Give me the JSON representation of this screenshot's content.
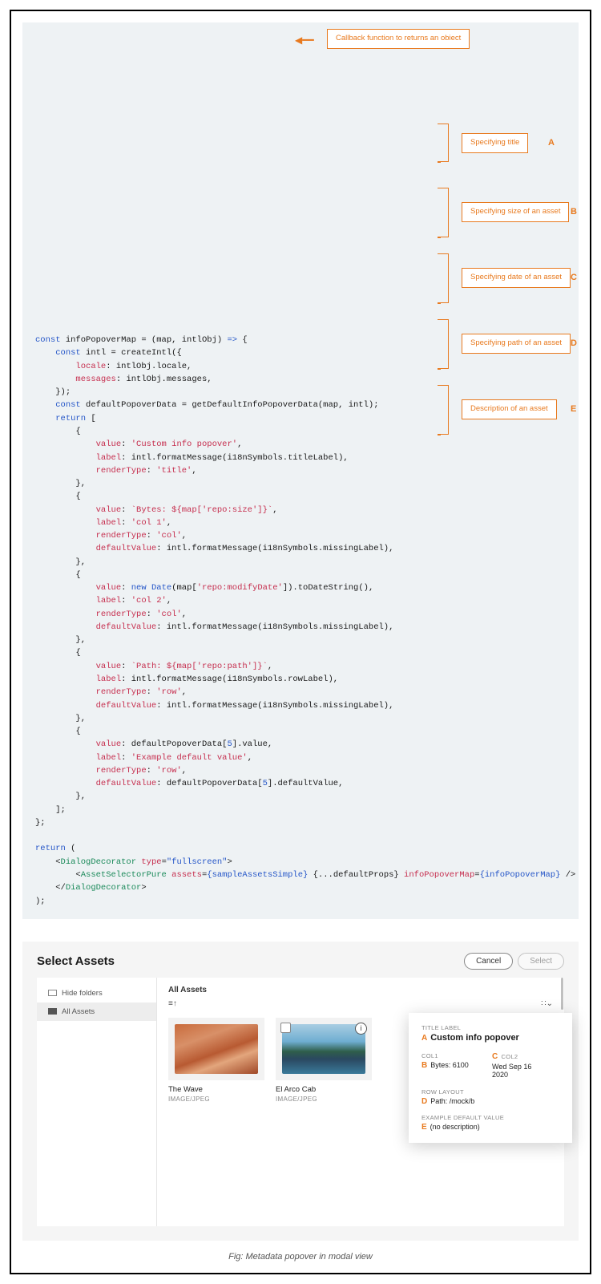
{
  "code": {
    "callout_top": "Callback function to returns an obiect",
    "annots": {
      "a": {
        "text": "Specifying title",
        "letter": "A"
      },
      "b": {
        "text": "Specifying size of an asset",
        "letter": "B"
      },
      "c": {
        "text": "Specifying date of an asset",
        "letter": "C"
      },
      "d": {
        "text": "Specifying path of an asset",
        "letter": "D"
      },
      "e": {
        "text": "Description of an asset",
        "letter": "E"
      }
    },
    "lines": {
      "l1_a": "const",
      "l1_b": " infoPopoverMap = (map, intlObj) ",
      "l1_c": "=>",
      "l1_d": " {",
      "l2_a": "const",
      "l2_b": " intl = createIntl({",
      "l3_a": "locale",
      "l3_b": ": intlObj.locale,",
      "l4_a": "messages",
      "l4_b": ": intlObj.messages,",
      "l5": "});",
      "l6_a": "const",
      "l6_b": " defaultPopoverData = getDefaultInfoPopoverData(map, intl);",
      "l7_a": "return",
      "l7_b": " [",
      "l8": "{",
      "l9_a": "value",
      "l9_b": ": ",
      "l9_c": "'Custom info popover'",
      "l9_d": ",",
      "l10_a": "label",
      "l10_b": ": intl.formatMessage(i18nSymbols.titleLabel),",
      "l11_a": "renderType",
      "l11_b": ": ",
      "l11_c": "'title'",
      "l11_d": ",",
      "l12": "},",
      "l13": "{",
      "l14_a": "value",
      "l14_b": ": ",
      "l14_c": "`Bytes: ${map['repo:size']}`",
      "l14_d": ",",
      "l15_a": "label",
      "l15_b": ": ",
      "l15_c": "'col 1'",
      "l15_d": ",",
      "l16_a": "renderType",
      "l16_b": ": ",
      "l16_c": "'col'",
      "l16_d": ",",
      "l17_a": "defaultValue",
      "l17_b": ": intl.formatMessage(i18nSymbols.missingLabel),",
      "l18": "},",
      "l19": "{",
      "l20_a": "value",
      "l20_b": ": ",
      "l20_c": "new",
      "l20_d": " ",
      "l20_e": "Date",
      "l20_f": "(map[",
      "l20_g": "'repo:modifyDate'",
      "l20_h": "]).toDateString(),",
      "l21_a": "label",
      "l21_b": ": ",
      "l21_c": "'col 2'",
      "l21_d": ",",
      "l22_a": "renderType",
      "l22_b": ": ",
      "l22_c": "'col'",
      "l22_d": ",",
      "l23_a": "defaultValue",
      "l23_b": ": intl.formatMessage(i18nSymbols.missingLabel),",
      "l24": "},",
      "l25": "{",
      "l26_a": "value",
      "l26_b": ": ",
      "l26_c": "`Path: ${map['repo:path']}`",
      "l26_d": ",",
      "l27_a": "label",
      "l27_b": ": intl.formatMessage(i18nSymbols.rowLabel),",
      "l28_a": "renderType",
      "l28_b": ": ",
      "l28_c": "'row'",
      "l28_d": ",",
      "l29_a": "defaultValue",
      "l29_b": ": intl.formatMessage(i18nSymbols.missingLabel),",
      "l30": "},",
      "l31": "{",
      "l32_a": "value",
      "l32_b": ": defaultPopoverData[",
      "l32_c": "5",
      "l32_d": "].value,",
      "l33_a": "label",
      "l33_b": ": ",
      "l33_c": "'Example default value'",
      "l33_d": ",",
      "l34_a": "renderType",
      "l34_b": ": ",
      "l34_c": "'row'",
      "l34_d": ",",
      "l35_a": "defaultValue",
      "l35_b": ": defaultPopoverData[",
      "l35_c": "5",
      "l35_d": "].defaultValue,",
      "l36": "},",
      "l37": "];",
      "l38": "};",
      "ret": "return",
      "ret2": " (",
      "dd_open_a": "DialogDecorator",
      "dd_type": "type",
      "dd_type_v": "\"fullscreen\"",
      "asp": "AssetSelectorPure",
      "asp_assets": "assets",
      "asp_assets_v": "{sampleAssetsSimple}",
      "asp_rest": " {...defaultProps} ",
      "asp_ipm": "infoPopoverMap",
      "asp_ipm_v": "{infoPopoverMap}",
      "dd_close": "DialogDecorator",
      "close_paren": ");"
    }
  },
  "modal": {
    "title": "Select Assets",
    "cancel": "Cancel",
    "select": "Select",
    "hide_folders": "Hide folders",
    "all_assets_side": "All Assets",
    "crumb": "All Assets",
    "card1_title": "The Wave",
    "card1_sub": "IMAGE/JPEG",
    "card2_title": "El Arco Cab",
    "card2_sub": "IMAGE/JPEG",
    "sort_icon": "≡↑",
    "grid_icon": "∷⌄"
  },
  "popover": {
    "title_label": "TITLE LABEL",
    "title_value": "Custom info popover",
    "col1_label": "COL1",
    "col1_value": "Bytes: 6100",
    "col2_label": "COL2",
    "col2_value_l1": "Wed Sep 16",
    "col2_value_l2": "2020",
    "row_label": "ROW LAYOUT",
    "row_value": "Path: /mock/b",
    "ex_label": "EXAMPLE DEFAULT VALUE",
    "ex_value": "(no description)",
    "letters": {
      "a": "A",
      "b": "B",
      "c": "C",
      "d": "D",
      "e": "E"
    }
  },
  "caption": "Fig: Metadata popover in modal view"
}
